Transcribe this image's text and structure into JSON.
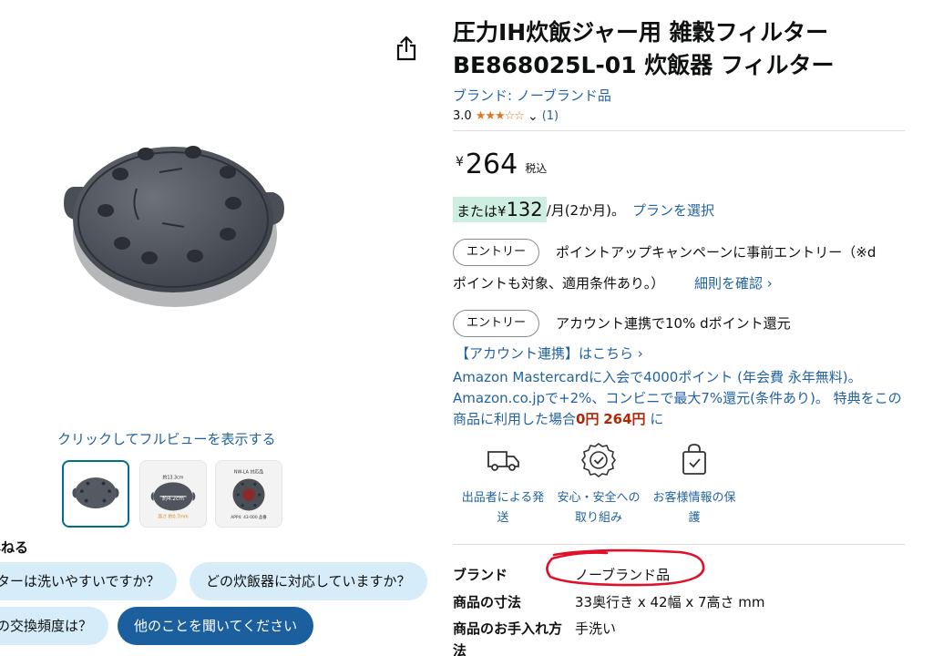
{
  "product": {
    "title": "圧力IH炊飯ジャー用 雑穀フィルター BE868025L-01 炊飯器 フィルター",
    "brand_link": "ブランド: ノーブランド品",
    "rating": "3.0",
    "stars": "★★★☆☆",
    "rating_chevron": "⌄",
    "rating_count": "(1)"
  },
  "price": {
    "symbol": "¥",
    "value": "264",
    "tax_label": "税込"
  },
  "installment": {
    "prefix": "または",
    "symbol": "¥",
    "amount": "132",
    "period": "/月(2か月)。",
    "plan_link": "プランを選択"
  },
  "promotions": [
    {
      "button": "エントリー",
      "line1": "ポイントアップキャンペーンに事前エントリー（※d",
      "line2": "ポイントも対象、適用条件あり。）",
      "link": "細則を確認 ›"
    },
    {
      "button": "エントリー",
      "line1": "アカウント連携で10% dポイント還元",
      "link": "【アカウント連携】はこちら ›"
    }
  ],
  "mastercard": {
    "text_before": "Amazon Mastercardに入会で4000ポイント (年会費 永年無料)。Amazon.co.jpで+2%、コンビニで最大7%還元(条件あり)。 特典をこの商品に利用した場合",
    "zero_price": "0円",
    "orig_price": "264円",
    "text_after": " に"
  },
  "features": [
    {
      "label": "出品者による発送",
      "icon": "truck-icon"
    },
    {
      "label": "安心・安全への取り組み",
      "icon": "badge-check-icon"
    },
    {
      "label": "お客様情報の保護",
      "icon": "secure-bag-icon"
    }
  ],
  "specs": [
    {
      "label": "ブランド",
      "value": "ノーブランド品"
    },
    {
      "label": "商品の寸法",
      "value": "33奥行き x 42幅 x 7高さ mm"
    },
    {
      "label": "商品のお手入れ方法",
      "value": "手洗い"
    }
  ],
  "media": {
    "full_view_link": "クリックしてフルビューを表示する",
    "thumb2_caption": "約4.2cm",
    "thumb2_top": "約13.3cm",
    "thumb2_bottom": "高さ 約0.7mm",
    "thumb3_top": "NW-LA 対応品",
    "thumb3_bottom": "APP4: 43-000 品番"
  },
  "ask": {
    "title": "尋ねる",
    "chips": [
      "ターは洗いやすいですか？",
      "どの炊飯器に対応していますか？",
      "の交換頻度は？",
      "他のことを聞いてください"
    ]
  },
  "colors": {
    "link": "#2162a1",
    "star": "#de7921",
    "installment_bg": "#cdeee0",
    "chip_bg": "#d6ecf9",
    "chip_dark": "#1b5f9e",
    "annotation_circle": "#e0102a"
  }
}
